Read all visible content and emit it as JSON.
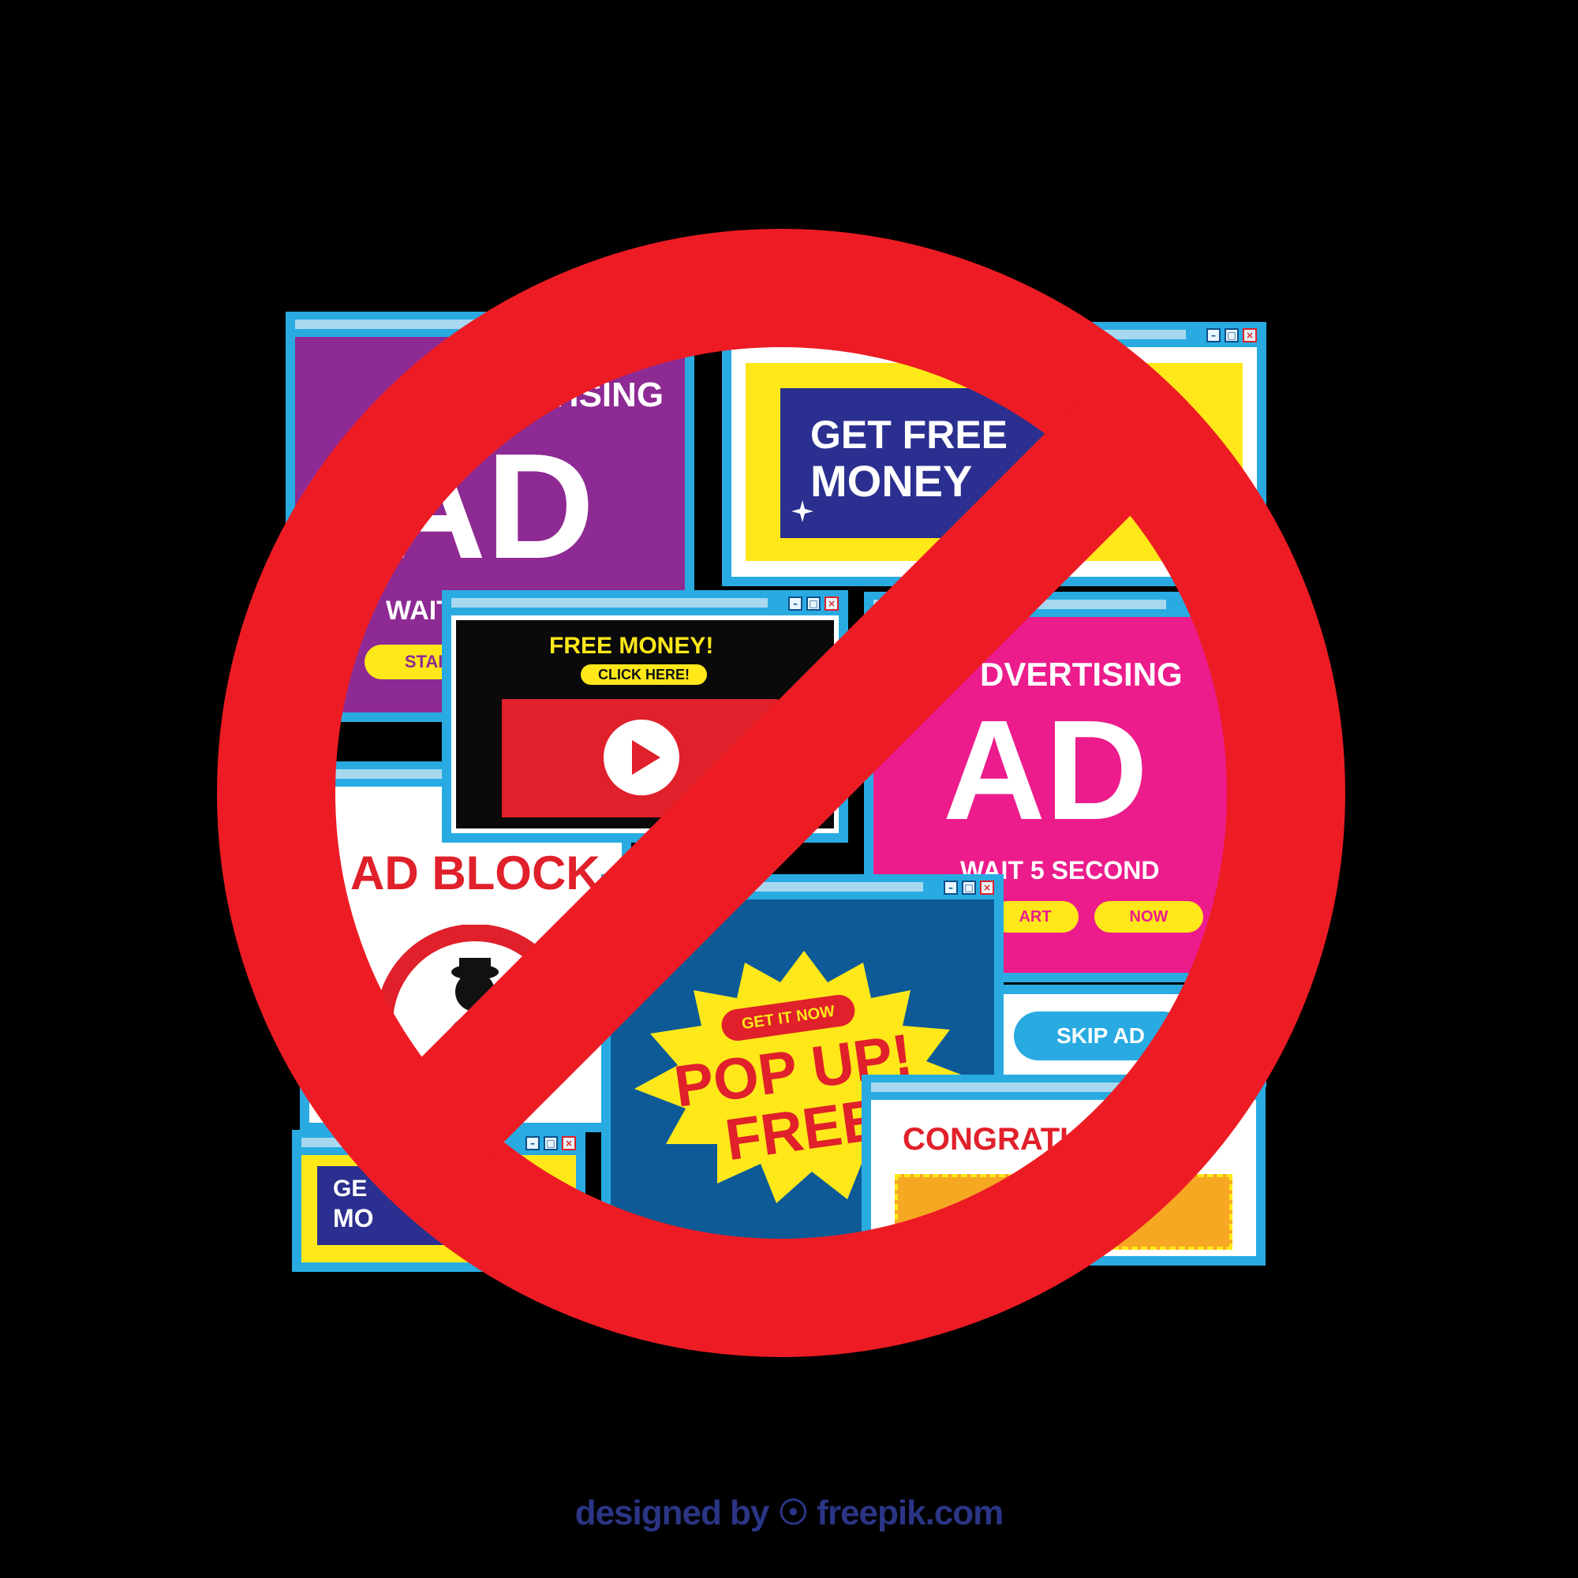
{
  "colors": {
    "background": "#000000",
    "window_frame": "#29abe2",
    "purple_ad": "#8e2a93",
    "magenta_ad": "#ec1c8c",
    "navy_panel": "#2b2f8f",
    "yellow": "#ffe81a",
    "red_sign": "#ed1c24",
    "dark_blue_popup": "#0d5a96"
  },
  "ads": {
    "purple": {
      "heading": "VERTISING",
      "big": "AD",
      "sub": "WAIT 5 SECOND",
      "button": "STAR"
    },
    "money_top": {
      "line1": "GET FREE",
      "line2": "MONEY"
    },
    "video": {
      "title": "FREE MONEY!",
      "cta": "CLICK HERE!"
    },
    "magenta": {
      "heading": "DVERTISING",
      "big": "AD",
      "sub": "WAIT 5 SECOND",
      "button_start": "ART",
      "button_now": "NOW"
    },
    "adblock": {
      "title": "AD BLOCK"
    },
    "skip": {
      "label": "SKIP AD"
    },
    "popup": {
      "small": "GET IT NOW",
      "line1": "POP UP!",
      "line2": "FREE"
    },
    "congrats": {
      "title": "CONGRATU"
    },
    "money_small": {
      "line1": "GE",
      "line2": "MO"
    }
  },
  "window_controls": {
    "minimize": "–",
    "maximize": "□",
    "close": "×"
  },
  "icons": {
    "play": "play-icon",
    "spy": "spy-icon",
    "sparkle": "sparkle-icon",
    "prohibition": "prohibition-icon",
    "skip_arrow": "chevron-right-icon"
  },
  "credit": {
    "text": "designed by ☉ freepik.com"
  }
}
